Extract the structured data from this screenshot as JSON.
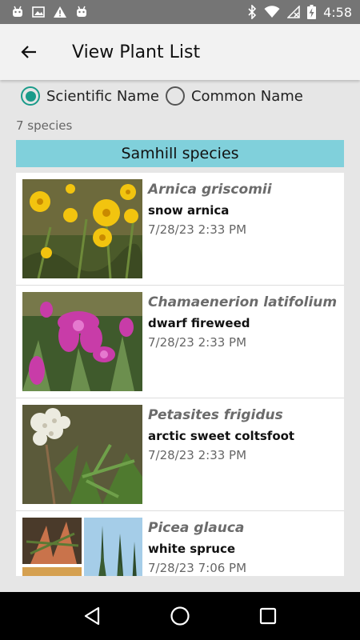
{
  "status_bar": {
    "time": "4:58",
    "left_icons": [
      "android-icon",
      "image-icon",
      "warning-icon",
      "android-icon"
    ],
    "right_icons": [
      "bluetooth-icon",
      "wifi-icon",
      "no-sim-icon",
      "battery-charging-icon"
    ]
  },
  "app_bar": {
    "title": "View Plant List",
    "back_icon": "arrow-back-icon"
  },
  "name_toggle": {
    "options": [
      {
        "label": "Scientific Name",
        "checked": true
      },
      {
        "label": "Common Name",
        "checked": false
      }
    ],
    "accent": "#1a9b8a"
  },
  "species_count": "7 species",
  "group": {
    "title": "Samhill species",
    "color": "#80d0db"
  },
  "plants": [
    {
      "scientific": "Arnica griscomii",
      "common": "snow arnica",
      "date": "7/28/23 2:33 PM"
    },
    {
      "scientific": "Chamaenerion latifolium",
      "common": "dwarf fireweed",
      "date": "7/28/23 2:33 PM"
    },
    {
      "scientific": "Petasites frigidus",
      "common": "arctic sweet coltsfoot",
      "date": "7/28/23 2:33 PM"
    },
    {
      "scientific": "Picea glauca",
      "common": "white spruce",
      "date": "7/28/23 7:06 PM"
    }
  ],
  "nav_bar": {
    "buttons": [
      "back-triangle-icon",
      "home-circle-icon",
      "recents-square-icon"
    ]
  }
}
